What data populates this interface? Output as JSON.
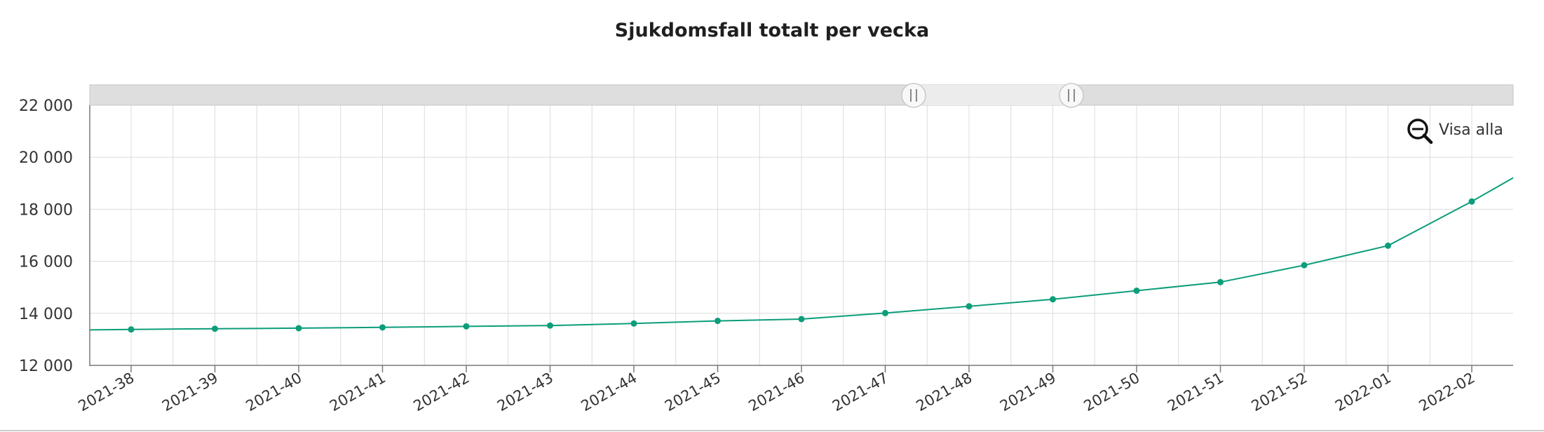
{
  "chart_data": {
    "type": "line",
    "title": "Sjukdomsfall totalt per vecka",
    "xlabel": "",
    "ylabel": "",
    "categories": [
      "2021-38",
      "2021-39",
      "2021-40",
      "2021-41",
      "2021-42",
      "2021-43",
      "2021-44",
      "2021-45",
      "2021-46",
      "2021-47",
      "2021-48",
      "2021-49",
      "2021-50",
      "2021-51",
      "2021-52",
      "2022-01",
      "2022-02"
    ],
    "series": [
      {
        "values": [
          13380,
          13410,
          13430,
          13460,
          13500,
          13530,
          13610,
          13710,
          13780,
          14010,
          14270,
          14540,
          14870,
          15200,
          15850,
          16600,
          18300
        ]
      }
    ],
    "ylim": [
      12000,
      22000
    ],
    "yticks": [
      12000,
      14000,
      16000,
      18000,
      20000,
      22000
    ],
    "ytick_labels": [
      "12 000",
      "14 000",
      "16 000",
      "18 000",
      "20 000",
      "22 000"
    ],
    "grid": true,
    "legend": "none",
    "line_color": "#0c9d7a",
    "grid_color": "#dcdcdc",
    "axis_color": "#7a7a7a",
    "scrollbar_color": "#dedede",
    "selection_color": "#ececec"
  },
  "zoom": {
    "label": "Visa alla",
    "icon": "zoom-out-icon"
  }
}
